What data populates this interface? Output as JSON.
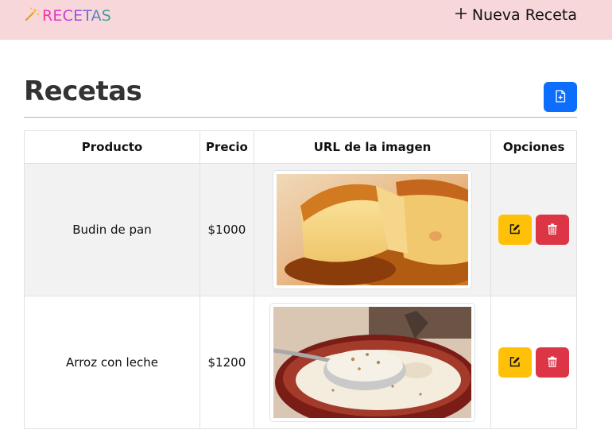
{
  "navbar": {
    "brand": "RECETAS",
    "brand_icon": "magic-wand-icon",
    "new_recipe_label": "Nueva Receta",
    "new_recipe_icon": "plus-icon",
    "background": "#f8d7da"
  },
  "page": {
    "title": "Recetas",
    "pdf_icon": "file-plus-icon"
  },
  "table": {
    "headers": {
      "product": "Producto",
      "price": "Precio",
      "image_url": "URL de la imagen",
      "options": "Opciones"
    },
    "rows": [
      {
        "product": "Budin de pan",
        "price": "$1000",
        "image": "flan-photo"
      },
      {
        "product": "Arroz con leche",
        "price": "$1200",
        "image": "rice-pudding-photo"
      }
    ]
  },
  "colors": {
    "primary": "#0d6efd",
    "warning": "#ffc107",
    "danger": "#dc3545",
    "divider": "#e6a1a8"
  }
}
